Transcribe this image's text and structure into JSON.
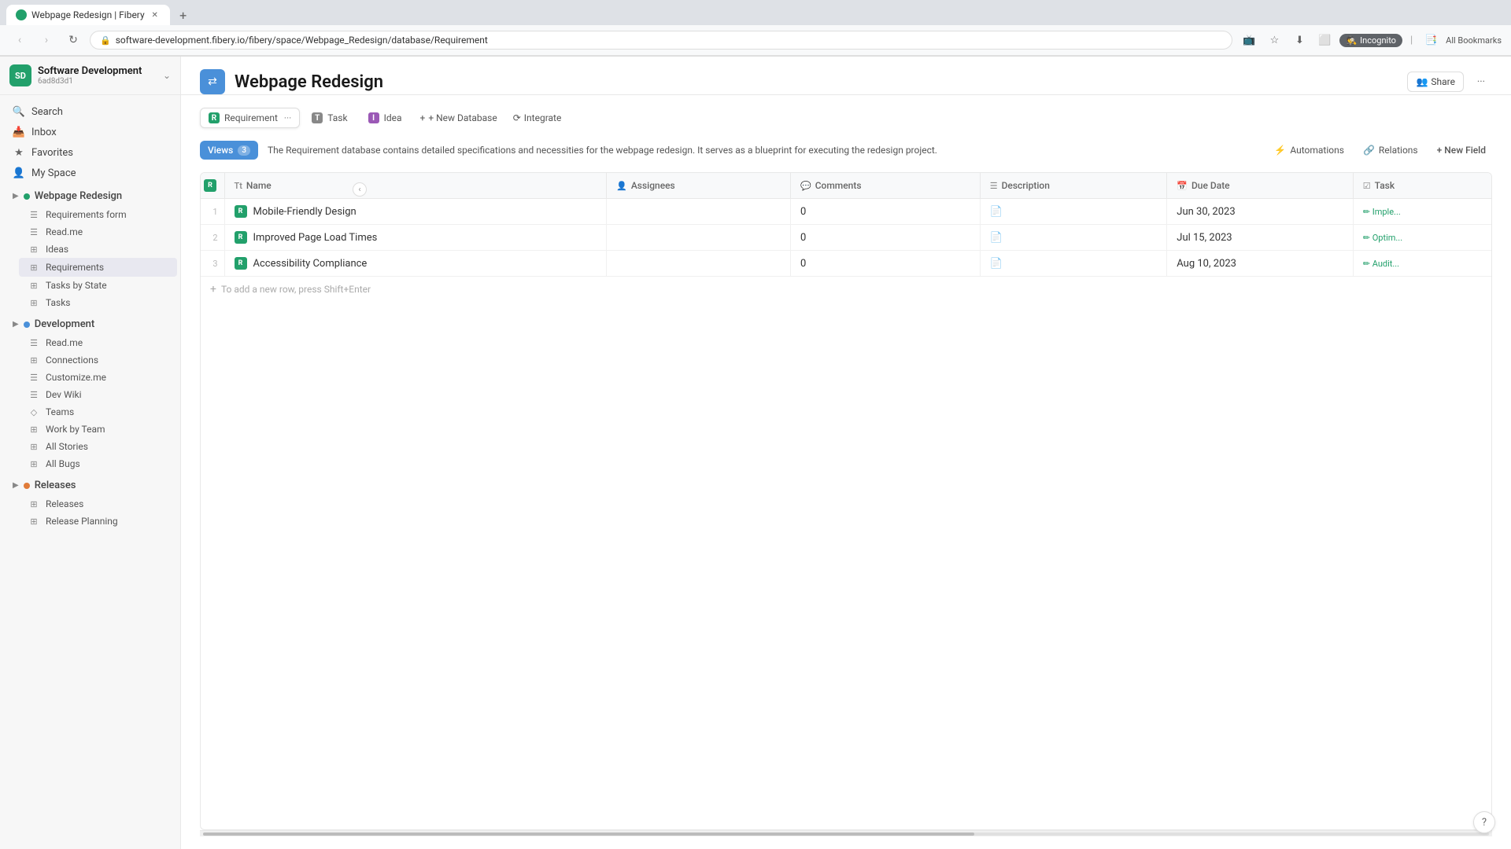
{
  "browser": {
    "tab_title": "Webpage Redesign | Fibery",
    "url": "software-development.fibery.io/fibery/space/Webpage_Redesign/database/Requirement",
    "incognito_label": "Incognito",
    "bookmarks_label": "All Bookmarks"
  },
  "workspace": {
    "name": "Software Development",
    "id": "6ad8d3d1",
    "icon_text": "SD"
  },
  "sidebar": {
    "search_label": "Search",
    "inbox_label": "Inbox",
    "favorites_label": "Favorites",
    "my_space_label": "My Space",
    "sections": [
      {
        "name": "Webpage Redesign",
        "color": "green",
        "children": [
          {
            "label": "Requirements form",
            "icon": "☰"
          },
          {
            "label": "Read.me",
            "icon": "☰"
          },
          {
            "label": "Ideas",
            "icon": "⊞"
          },
          {
            "label": "Requirements",
            "icon": "⊞",
            "active": true
          },
          {
            "label": "Tasks by State",
            "icon": "⊞"
          },
          {
            "label": "Tasks",
            "icon": "⊞"
          }
        ]
      },
      {
        "name": "Development",
        "color": "blue",
        "children": [
          {
            "label": "Read.me",
            "icon": "☰"
          },
          {
            "label": "Connections",
            "icon": "⊞"
          },
          {
            "label": "Customize.me",
            "icon": "☰"
          },
          {
            "label": "Dev Wiki",
            "icon": "☰"
          },
          {
            "label": "Teams",
            "icon": "◇"
          },
          {
            "label": "Work by Team",
            "icon": "⊞"
          },
          {
            "label": "All Stories",
            "icon": "⊞"
          },
          {
            "label": "All Bugs",
            "icon": "⊞"
          }
        ]
      },
      {
        "name": "Releases",
        "color": "orange",
        "children": [
          {
            "label": "Releases",
            "icon": "⊞"
          },
          {
            "label": "Release Planning",
            "icon": "⊞"
          }
        ]
      }
    ]
  },
  "page": {
    "title": "Webpage Redesign",
    "share_label": "Share",
    "more_label": "..."
  },
  "tabs": [
    {
      "label": "Requirement",
      "icon": "R",
      "type": "req",
      "active": true
    },
    {
      "label": "Task",
      "icon": "T",
      "type": "task",
      "active": false
    },
    {
      "label": "Idea",
      "icon": "I",
      "type": "idea",
      "active": false
    }
  ],
  "toolbar_buttons": {
    "new_database_label": "+ New Database",
    "integrate_label": "Integrate"
  },
  "views_btn": {
    "label": "Views",
    "count": "3"
  },
  "description": "The Requirement database contains detailed specifications and necessities for the webpage redesign. It serves as a blueprint for executing the redesign project.",
  "toolbar_right": {
    "automations_label": "Automations",
    "relations_label": "Relations",
    "new_field_label": "+ New Field"
  },
  "table": {
    "columns": [
      {
        "label": "Name",
        "icon": "Tt"
      },
      {
        "label": "Assignees",
        "icon": "👤"
      },
      {
        "label": "Comments",
        "icon": "💬"
      },
      {
        "label": "Description",
        "icon": "☰"
      },
      {
        "label": "Due Date",
        "icon": "📅"
      },
      {
        "label": "Task",
        "icon": "☑"
      }
    ],
    "rows": [
      {
        "num": "1",
        "name": "Mobile-Friendly Design",
        "assignees": "",
        "comments": "0",
        "description": "📄",
        "due_date": "Jun 30, 2023",
        "task": "Imple..."
      },
      {
        "num": "2",
        "name": "Improved Page Load Times",
        "assignees": "",
        "comments": "0",
        "description": "📄",
        "due_date": "Jul 15, 2023",
        "task": "Optim..."
      },
      {
        "num": "3",
        "name": "Accessibility Compliance",
        "assignees": "",
        "comments": "0",
        "description": "📄",
        "due_date": "Aug 10, 2023",
        "task": "Audit..."
      }
    ],
    "add_row_hint": "To add a new row, press Shift+Enter"
  },
  "help_label": "?"
}
